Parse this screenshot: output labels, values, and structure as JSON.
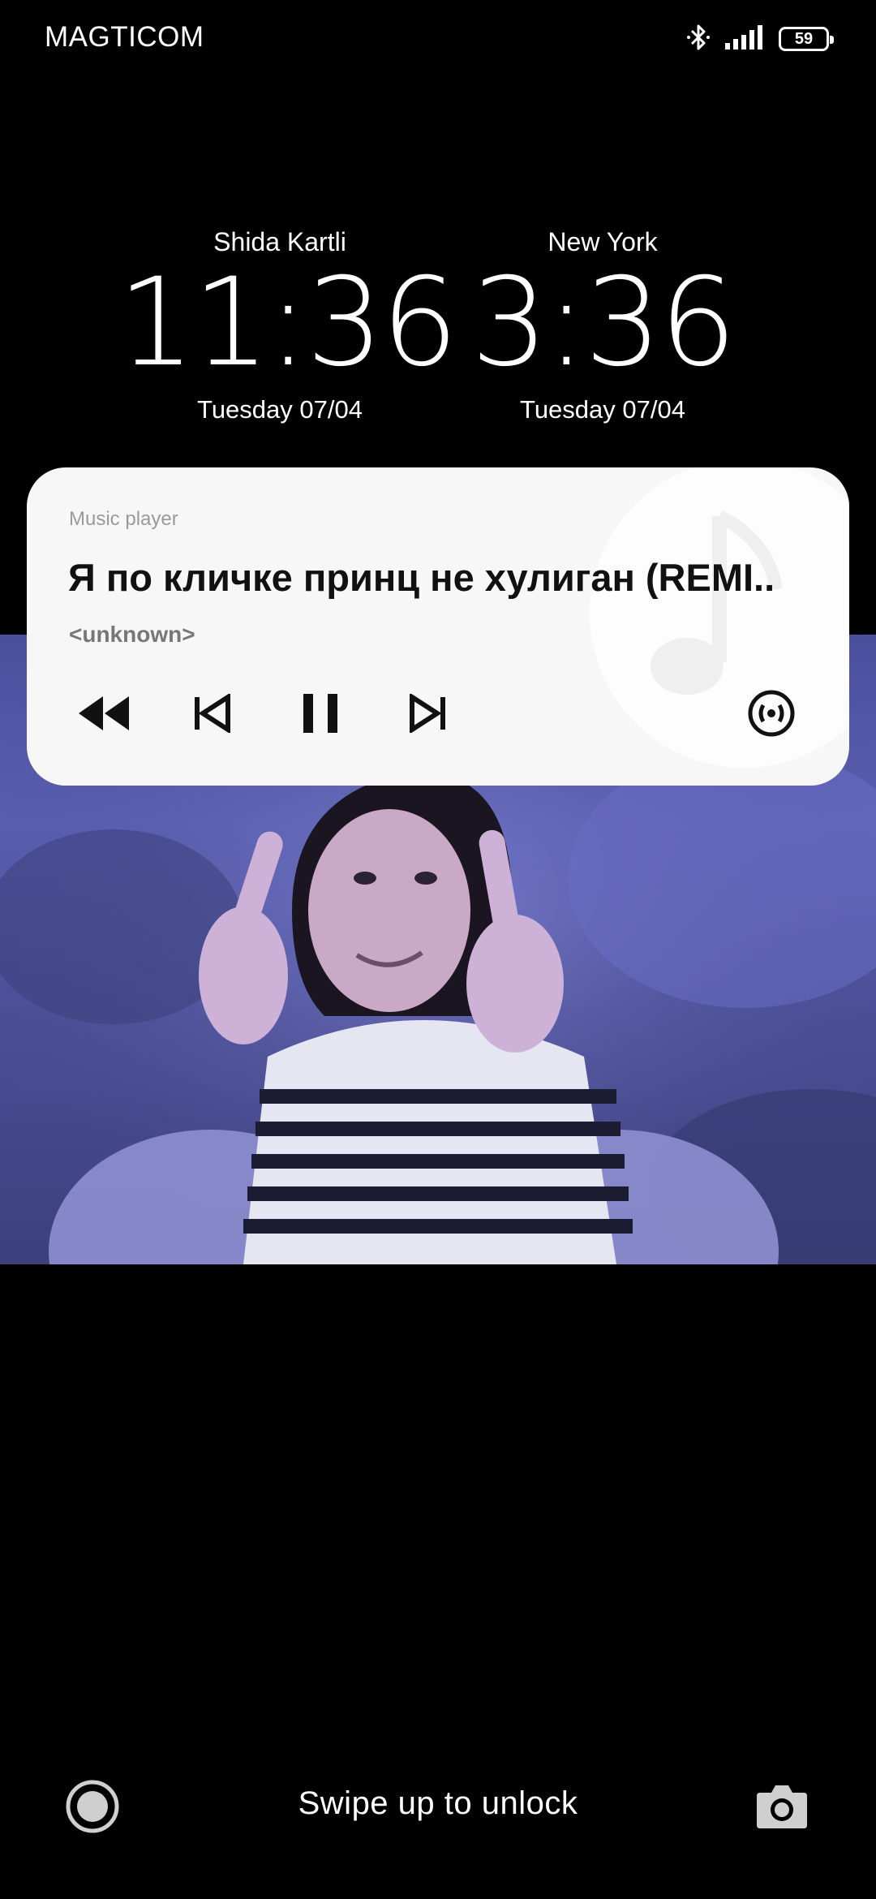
{
  "status_bar": {
    "carrier": "MAGTICOM",
    "battery_level": "59",
    "icons": [
      "bluetooth-icon",
      "signal-icon",
      "battery-icon"
    ]
  },
  "clocks": [
    {
      "city": "Shida Kartli",
      "time": "11:36",
      "date": "Tuesday 07/04"
    },
    {
      "city": "New York",
      "time": "3:36",
      "date": "Tuesday 07/04"
    }
  ],
  "music_player": {
    "app_name": "Music player",
    "title": "Я по кличке принц не хулиган (REMI..",
    "artist": "<unknown>",
    "controls": [
      "rewind-icon",
      "previous-track-icon",
      "pause-icon",
      "next-track-icon",
      "cast-icon"
    ],
    "background_color": "#f7f7f7"
  },
  "lockscreen": {
    "unlock_hint": "Swipe up to unlock",
    "left_shortcut": "assistant-icon",
    "right_shortcut": "camera-icon"
  },
  "colors": {
    "background": "#000000",
    "wallpaper_tint": "#5a5fb4"
  }
}
